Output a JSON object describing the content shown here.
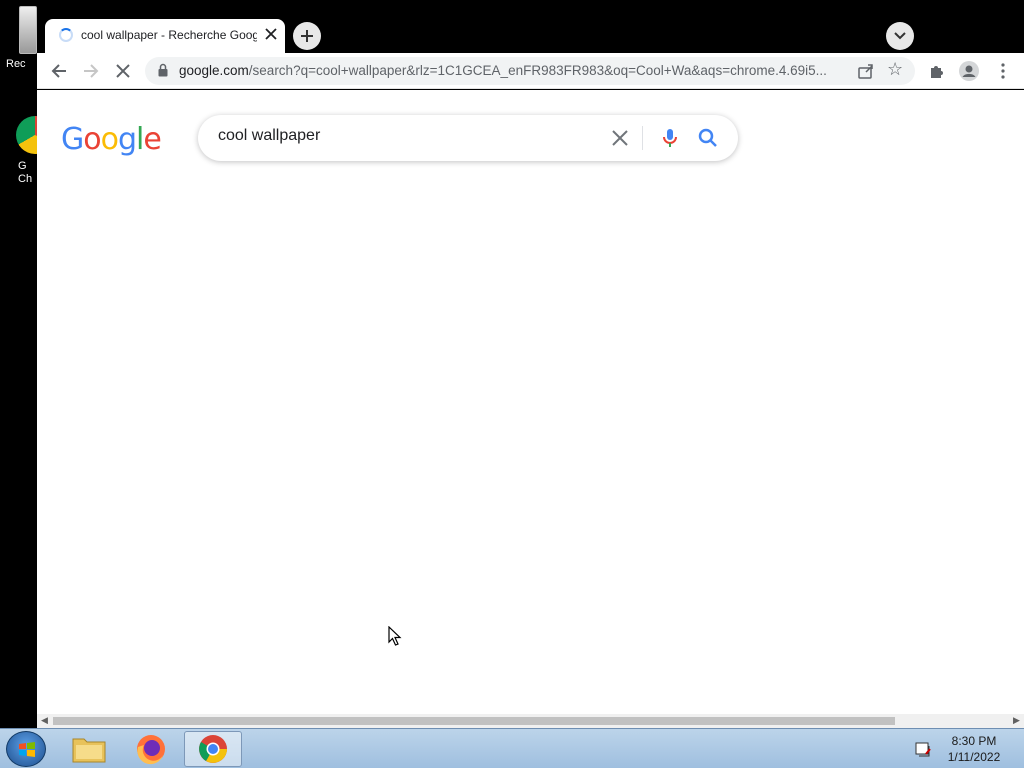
{
  "desktop": {
    "icons": [
      {
        "label": "Rec"
      },
      {
        "label": "G\nCh"
      }
    ]
  },
  "browser": {
    "tab": {
      "title": "cool wallpaper - Recherche Goog"
    },
    "address": {
      "host": "google.com",
      "rest": "/search?q=cool+wallpaper&rlz=1C1GCEA_enFR983FR983&oq=Cool+Wa&aqs=chrome.4.69i5..."
    }
  },
  "page": {
    "logo_letters": [
      "G",
      "o",
      "o",
      "g",
      "l",
      "e"
    ],
    "search_value": "cool wallpaper"
  },
  "taskbar": {
    "time": "8:30 PM",
    "date": "1/11/2022"
  },
  "icons": {
    "tab_spinner": "loading-spinner-icon",
    "close": "close-icon",
    "new_tab": "plus-icon",
    "tab_search": "chevron-down-icon",
    "back": "back-arrow-icon",
    "forward": "forward-arrow-icon",
    "stop": "stop-icon",
    "lock": "lock-icon",
    "share": "share-icon",
    "bookmark": "star-icon",
    "extensions": "puzzle-icon",
    "profile": "profile-icon",
    "menu": "kebab-menu-icon",
    "clear": "clear-icon",
    "voice": "microphone-icon",
    "search": "search-icon"
  },
  "colors": {
    "google_blue": "#4285f4",
    "google_red": "#ea4335",
    "google_yellow": "#fbbc05",
    "google_green": "#34a853"
  }
}
